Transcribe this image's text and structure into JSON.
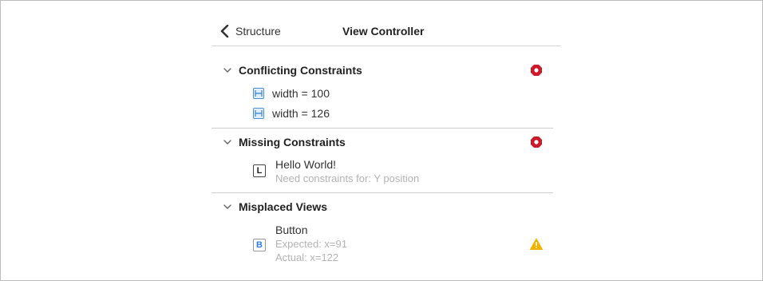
{
  "nav": {
    "back_label": "Structure",
    "title": "View Controller"
  },
  "sections": [
    {
      "title": "Conflicting Constraints",
      "status": "error",
      "items": [
        {
          "icon": "width-constraint-icon",
          "label": "width = 100"
        },
        {
          "icon": "width-constraint-icon",
          "label": "width = 126"
        }
      ]
    },
    {
      "title": "Missing Constraints",
      "status": "error",
      "items": [
        {
          "icon": "label-icon",
          "icon_letter": "L",
          "label": "Hello World!",
          "detail": "Need constraints for: Y position"
        }
      ]
    },
    {
      "title": "Misplaced Views",
      "items": [
        {
          "icon": "button-icon",
          "icon_letter": "B",
          "label": "Button",
          "expected": "Expected: x=91",
          "actual": "Actual: x=122",
          "status": "warning"
        }
      ]
    }
  ],
  "colors": {
    "error": "#cc1a2b",
    "warning": "#f0b400",
    "constraint_blue": "#4a90d9"
  }
}
